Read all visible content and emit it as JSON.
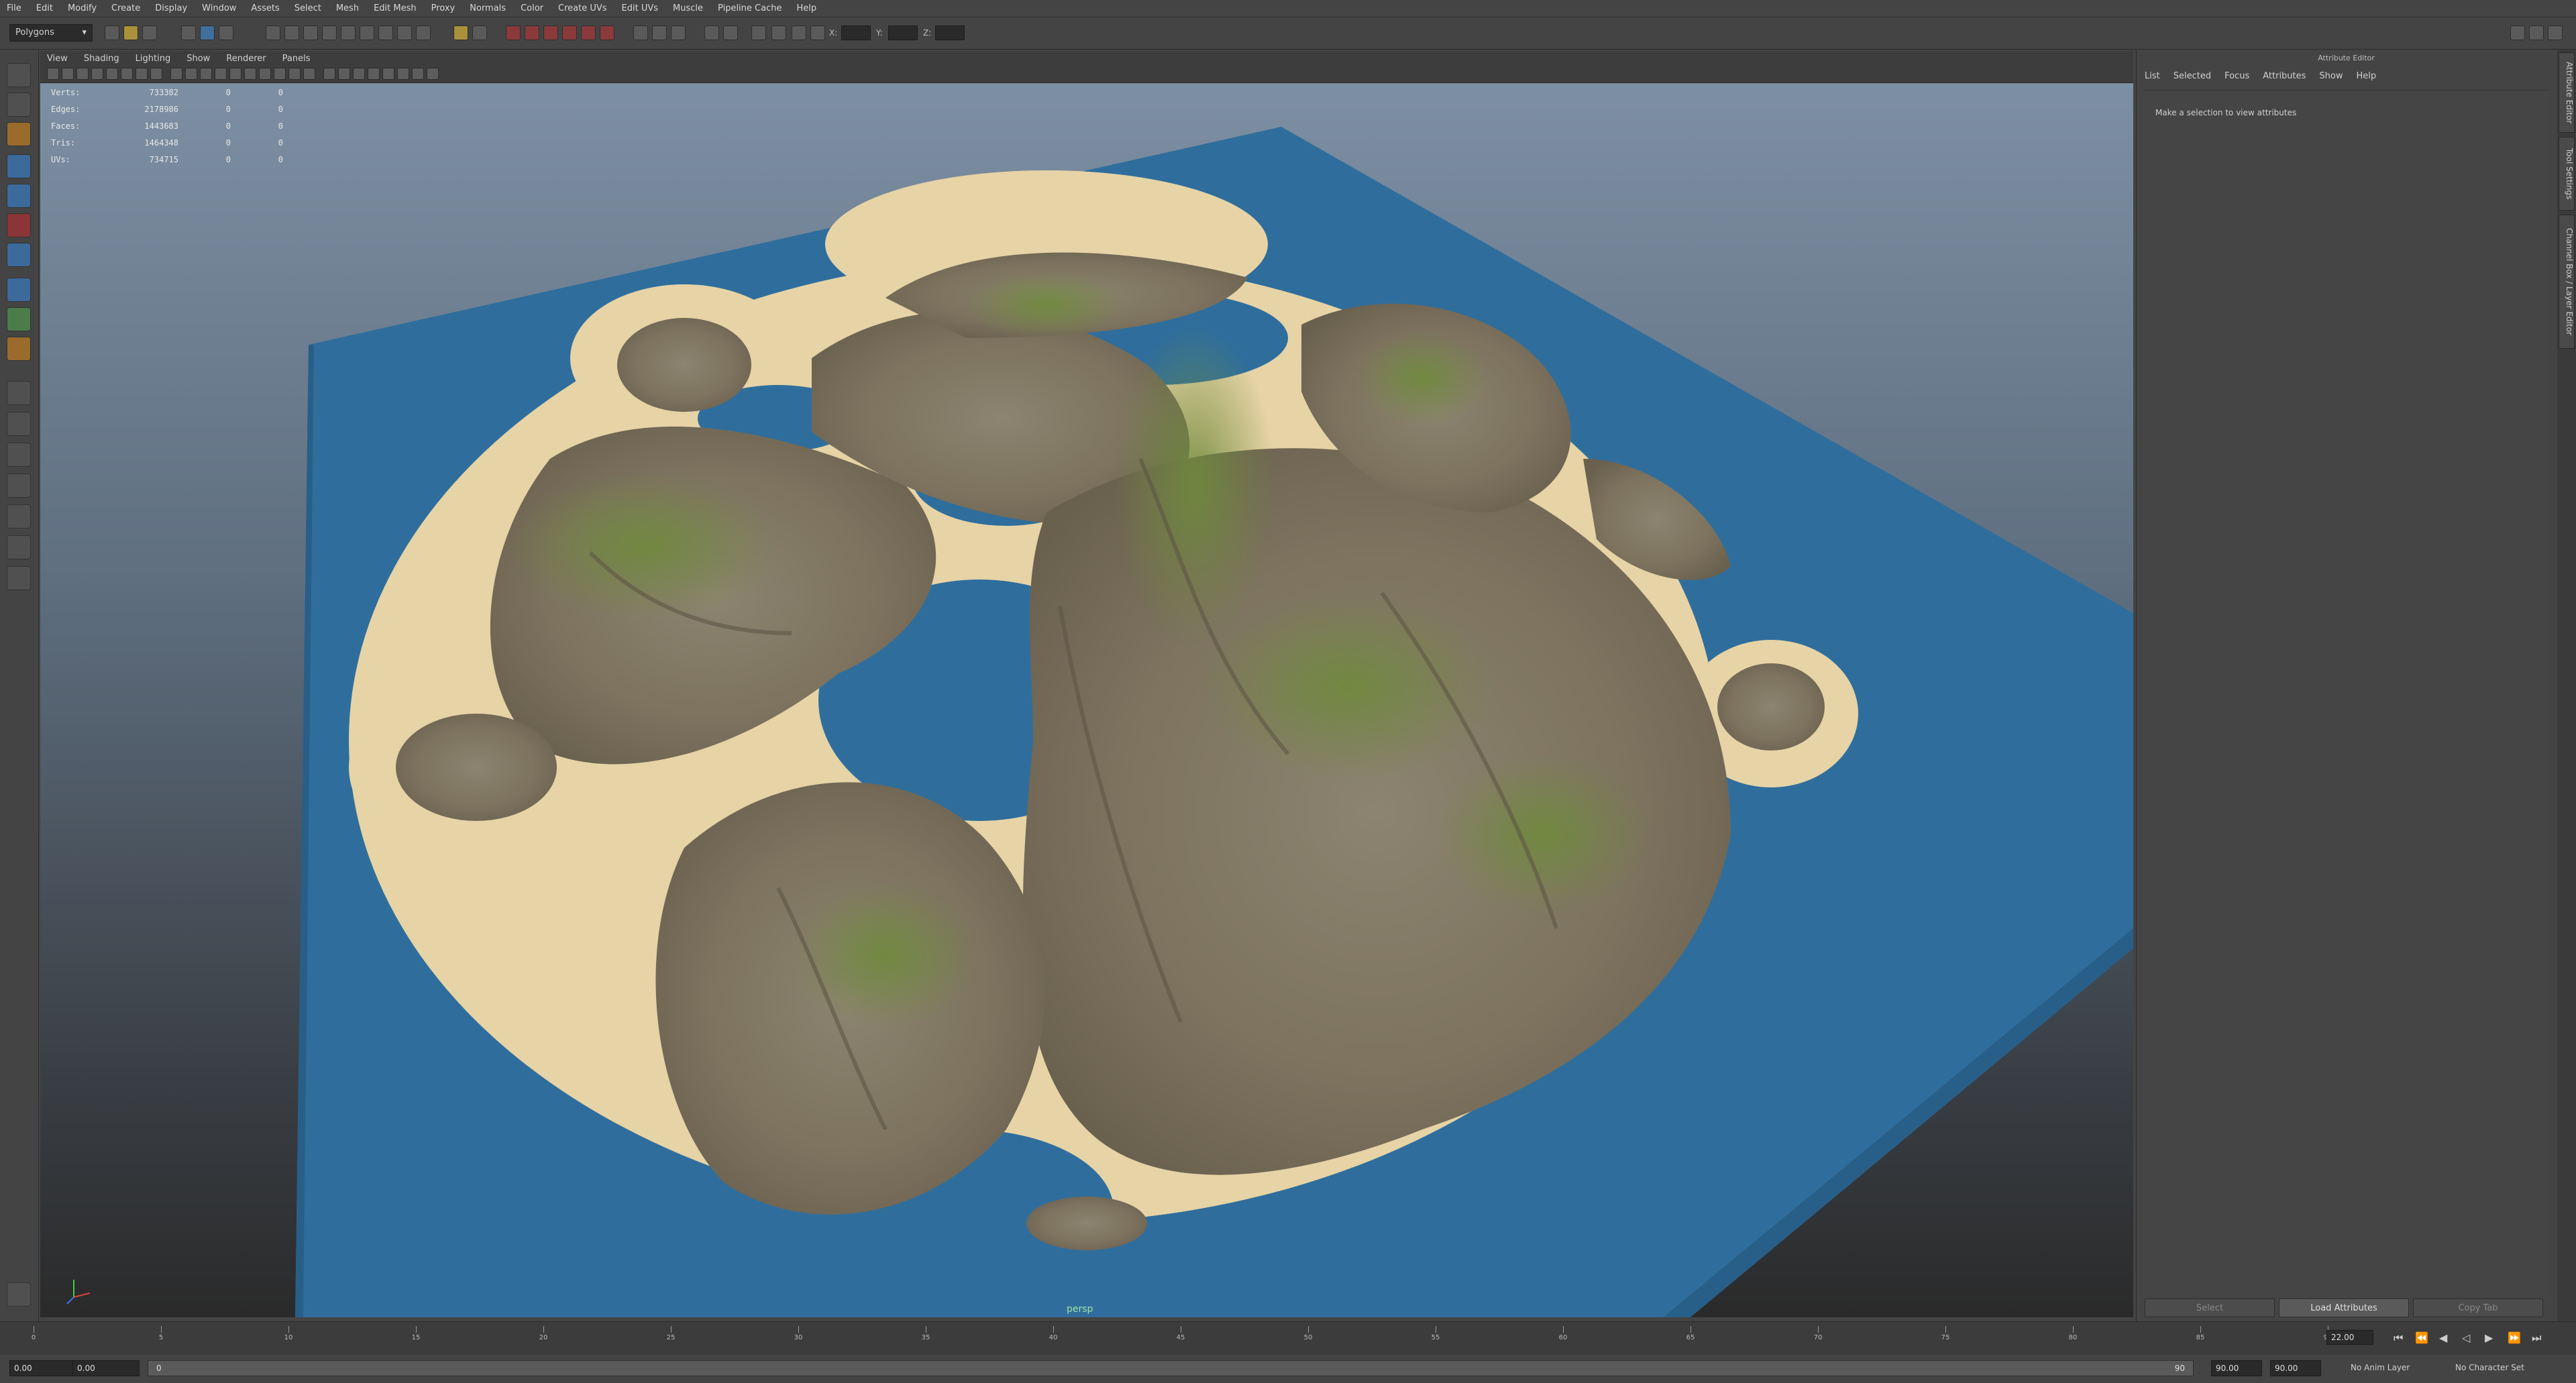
{
  "menu": [
    "File",
    "Edit",
    "Modify",
    "Create",
    "Display",
    "Window",
    "Assets",
    "Select",
    "Mesh",
    "Edit Mesh",
    "Proxy",
    "Normals",
    "Color",
    "Create UVs",
    "Edit UVs",
    "Muscle",
    "Pipeline Cache",
    "Help"
  ],
  "status": {
    "mode": "Polygons",
    "x_label": "X:",
    "y_label": "Y:",
    "z_label": "Z:"
  },
  "panel_menu": [
    "View",
    "Shading",
    "Lighting",
    "Show",
    "Renderer",
    "Panels"
  ],
  "hud": [
    {
      "label": "Verts:",
      "total": "733382",
      "sel": "0",
      "uv": "0"
    },
    {
      "label": "Edges:",
      "total": "2178986",
      "sel": "0",
      "uv": "0"
    },
    {
      "label": "Faces:",
      "total": "1443683",
      "sel": "0",
      "uv": "0"
    },
    {
      "label": "Tris:",
      "total": "1464348",
      "sel": "0",
      "uv": "0"
    },
    {
      "label": "UVs:",
      "total": "734715",
      "sel": "0",
      "uv": "0"
    }
  ],
  "viewport": {
    "camera": "persp"
  },
  "attribute_editor": {
    "title": "Attribute Editor",
    "menu": [
      "List",
      "Selected",
      "Focus",
      "Attributes",
      "Show",
      "Help"
    ],
    "message": "Make a selection to view attributes",
    "buttons": {
      "select": "Select",
      "load": "Load Attributes",
      "copy": "Copy Tab"
    }
  },
  "side_tabs": [
    "Attribute Editor",
    "Tool Settings",
    "Channel Box / Layer Editor"
  ],
  "timeline": {
    "start": 0,
    "end": 90,
    "step": 5,
    "current_frame": "22.00"
  },
  "range": {
    "start": "0.00",
    "start2": "0.00",
    "bar_start": "0",
    "bar_end": "90",
    "end": "90.00",
    "end2": "90.00",
    "anim_layer": "No Anim Layer",
    "char_set": "No Character Set"
  },
  "colors": {
    "water": "#2f6e9c",
    "sand": "#e6d3a6",
    "rock": "#8b7f6a",
    "grass": "#6f8a3c"
  }
}
